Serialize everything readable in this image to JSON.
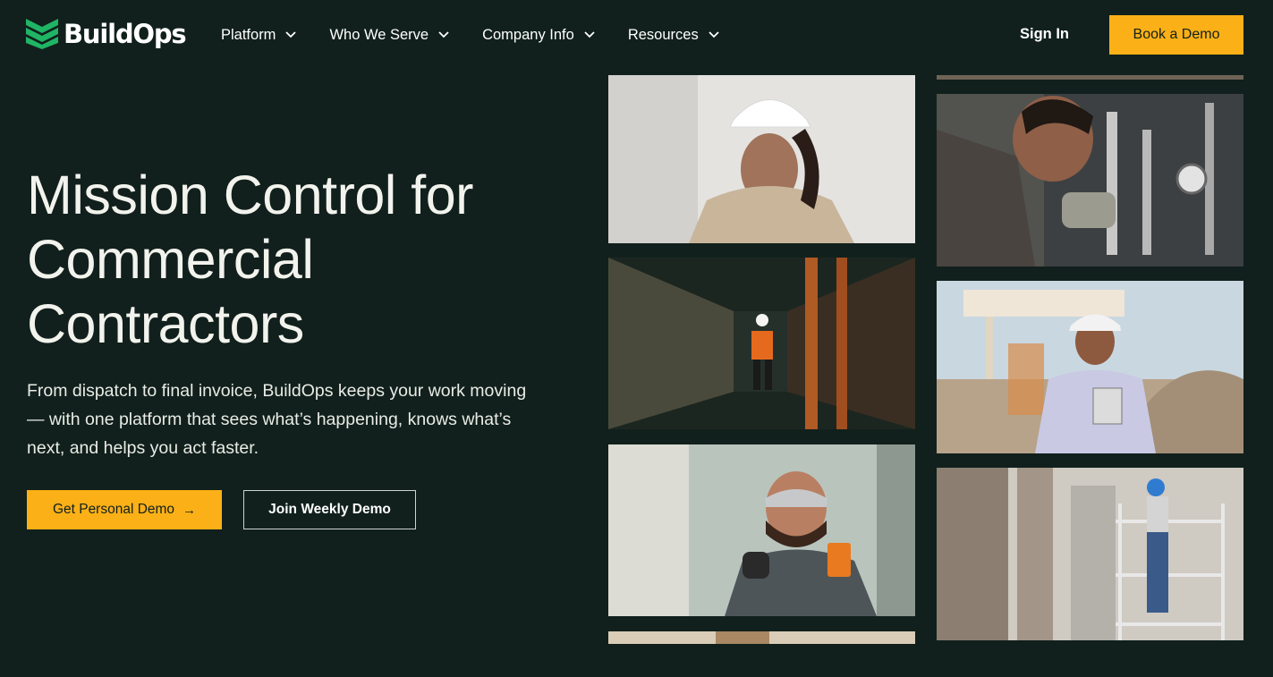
{
  "brand": {
    "name": "BuildOps",
    "logo_icon": "chevron-stack-logo",
    "accent": "#1fb565"
  },
  "nav": {
    "items": [
      {
        "label": "Platform",
        "icon": "chevron-down-icon"
      },
      {
        "label": "Who We Serve",
        "icon": "chevron-down-icon"
      },
      {
        "label": "Company Info",
        "icon": "chevron-down-icon"
      },
      {
        "label": "Resources",
        "icon": "chevron-down-icon"
      }
    ],
    "sign_in": "Sign In",
    "book_demo": "Book a Demo"
  },
  "hero": {
    "title_lines": [
      "Mission Control for",
      "Commercial",
      "Contractors"
    ],
    "subtitle": "From dispatch to final invoice, BuildOps keeps your work moving — with one platform that sees what’s happening, knows what’s next, and helps you act faster.",
    "primary_cta": "Get Personal Demo",
    "primary_cta_icon": "arrow-right-icon",
    "secondary_cta": "Join Weekly Demo"
  },
  "colors": {
    "background": "#11201c",
    "cta_yellow": "#fbb017",
    "text": "#ffffff"
  },
  "photos": [
    {
      "subject": "woman-in-hard-hat"
    },
    {
      "subject": "technician-with-pipes-and-gauges"
    },
    {
      "subject": "warehouse-worker-in-safety-vest"
    },
    {
      "subject": "smiling-man-with-tablet"
    },
    {
      "subject": "electrician-with-multimeter"
    },
    {
      "subject": "worker-on-scaffolding"
    }
  ]
}
